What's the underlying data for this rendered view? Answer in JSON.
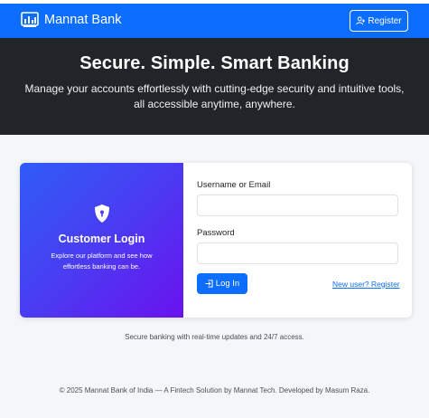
{
  "navbar": {
    "brand": "Mannat Bank",
    "brand_icon": "bank-chart-icon",
    "register_label": "Register",
    "register_icon": "person-add-icon",
    "color": "#0d6efd"
  },
  "hero": {
    "title": "Secure. Simple. Smart Banking",
    "subtitle": "Manage your accounts effortlessly with cutting-edge security and intuitive tools, all accessible anytime, anywhere."
  },
  "login_card": {
    "left": {
      "icon": "shield-lock-icon",
      "title": "Customer Login",
      "description": "Explore our platform and see how effortless banking can be."
    },
    "form": {
      "username_label": "Username or Email",
      "username_value": "",
      "password_label": "Password",
      "password_value": "",
      "login_label": "Log In",
      "login_icon": "login-arrow-icon",
      "new_user_link": "New user? Register"
    }
  },
  "tagline": "Secure banking with real-time updates and 24/7 access.",
  "footer": "© 2025 Mannat Bank of India — A Fintech Solution by Mannat Tech. Developed by Masum Raza."
}
